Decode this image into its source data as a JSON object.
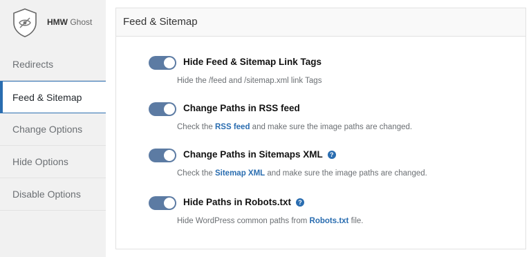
{
  "brand": {
    "name": "HMW",
    "suffix": "Ghost",
    "logo_icon": "shield-eye-off-icon"
  },
  "sidebar": {
    "items": [
      {
        "label": "Redirects",
        "active": false
      },
      {
        "label": "Feed & Sitemap",
        "active": true
      },
      {
        "label": "Change Options",
        "active": false
      },
      {
        "label": "Hide Options",
        "active": false
      },
      {
        "label": "Disable Options",
        "active": false
      }
    ]
  },
  "panel": {
    "title": "Feed & Sitemap",
    "options": [
      {
        "title": "Hide Feed & Sitemap Link Tags",
        "enabled": true,
        "help": false,
        "desc_before": "Hide the /feed and /sitemap.xml link Tags",
        "desc_link": "",
        "desc_after": ""
      },
      {
        "title": "Change Paths in RSS feed",
        "enabled": true,
        "help": false,
        "desc_before": "Check the ",
        "desc_link": "RSS feed",
        "desc_after": " and make sure the image paths are changed."
      },
      {
        "title": "Change Paths in Sitemaps XML",
        "enabled": true,
        "help": true,
        "desc_before": "Check the ",
        "desc_link": "Sitemap XML",
        "desc_after": " and make sure the image paths are changed."
      },
      {
        "title": "Hide Paths in Robots.txt",
        "enabled": true,
        "help": true,
        "desc_before": "Hide WordPress common paths from ",
        "desc_link": "Robots.txt",
        "desc_after": " file."
      }
    ]
  },
  "colors": {
    "accent": "#2a6db0",
    "toggle_on": "#5c7ba3"
  }
}
